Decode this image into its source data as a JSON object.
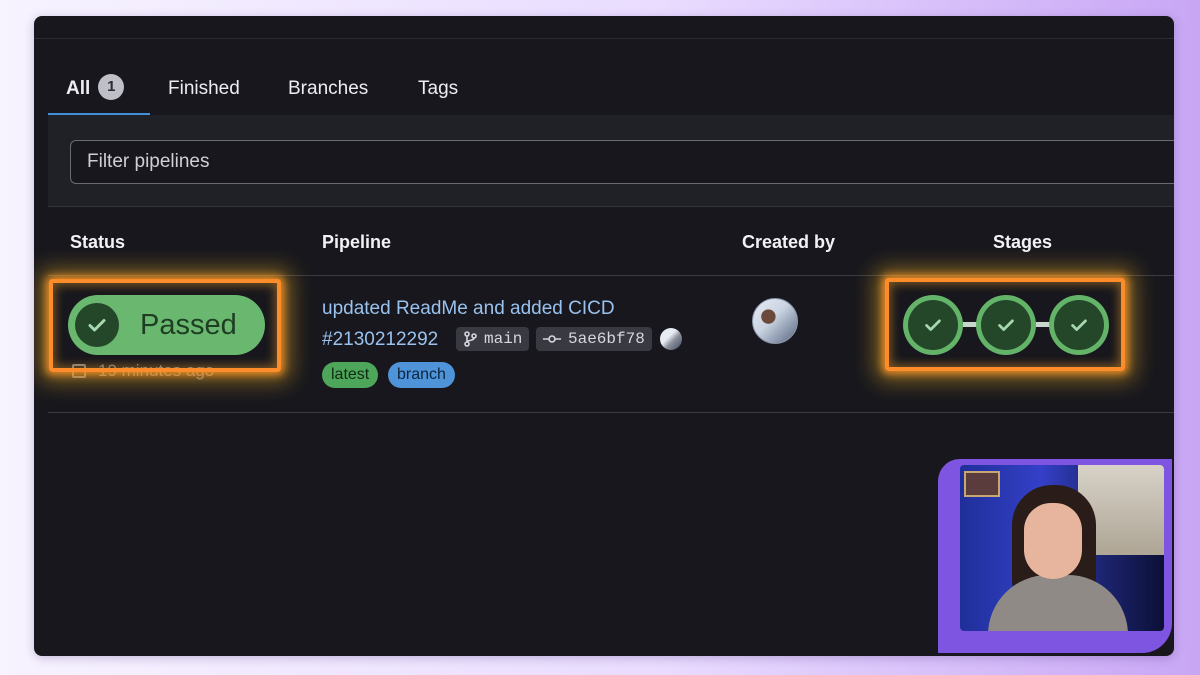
{
  "tabs": [
    {
      "label": "All",
      "count": "1",
      "active": true
    },
    {
      "label": "Finished",
      "active": false
    },
    {
      "label": "Branches",
      "active": false
    },
    {
      "label": "Tags",
      "active": false
    }
  ],
  "filter": {
    "placeholder": "Filter pipelines"
  },
  "table": {
    "headers": {
      "status": "Status",
      "pipeline": "Pipeline",
      "created_by": "Created by",
      "stages": "Stages"
    },
    "rows": [
      {
        "status": "Passed",
        "time": "19 minutes ago",
        "title": "updated ReadMe and added CICD",
        "id": "#2130212292",
        "branch": "main",
        "commit": "5ae6bf78",
        "tags": [
          "latest",
          "branch"
        ],
        "stages": [
          "passed",
          "passed",
          "passed"
        ]
      }
    ]
  },
  "icons": {
    "status": "check-icon",
    "branch": "git-branch-icon",
    "commit": "git-commit-icon",
    "time": "calendar-icon"
  },
  "colors": {
    "accent": "#428fdc",
    "success": "#6ab86f",
    "highlight": "#ff8c2a",
    "link": "#9ac2ee",
    "webcam_border": "#7e55e0"
  }
}
